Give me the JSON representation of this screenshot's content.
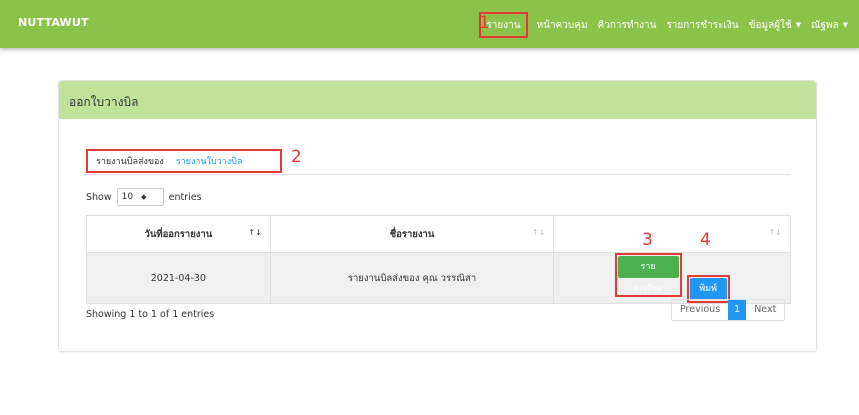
{
  "navbar": {
    "brand": "NUTTAWUT",
    "items": [
      "รายงาน",
      "หน้าควบคุม",
      "คิวการทำงาน",
      "รายการชำระเงิน",
      "ข้อมูลผู้ใช้",
      "ณัฐพล"
    ]
  },
  "markers": [
    "1",
    "2",
    "3",
    "4"
  ],
  "card": {
    "title": "ออกใบวางบิล"
  },
  "tabs": [
    "รายงานบิลส่งของ",
    "รายงานใบวางบิล"
  ],
  "length": {
    "show": "Show",
    "value": "10",
    "entries": "entries"
  },
  "table": {
    "headers": [
      "วันที่ออกรายงาน",
      "ชื่อรายงาน",
      ""
    ],
    "rows": [
      {
        "date": "2021-04-30",
        "name": "รายงานบิลส่งของ คุณ วรรณิสา",
        "detail": "รายละเอียด",
        "print": "พิมพ์"
      }
    ]
  },
  "info": "Showing 1 to 1 of 1 entries",
  "pager": {
    "previous": "Previous",
    "current": "1",
    "next": "Next"
  }
}
